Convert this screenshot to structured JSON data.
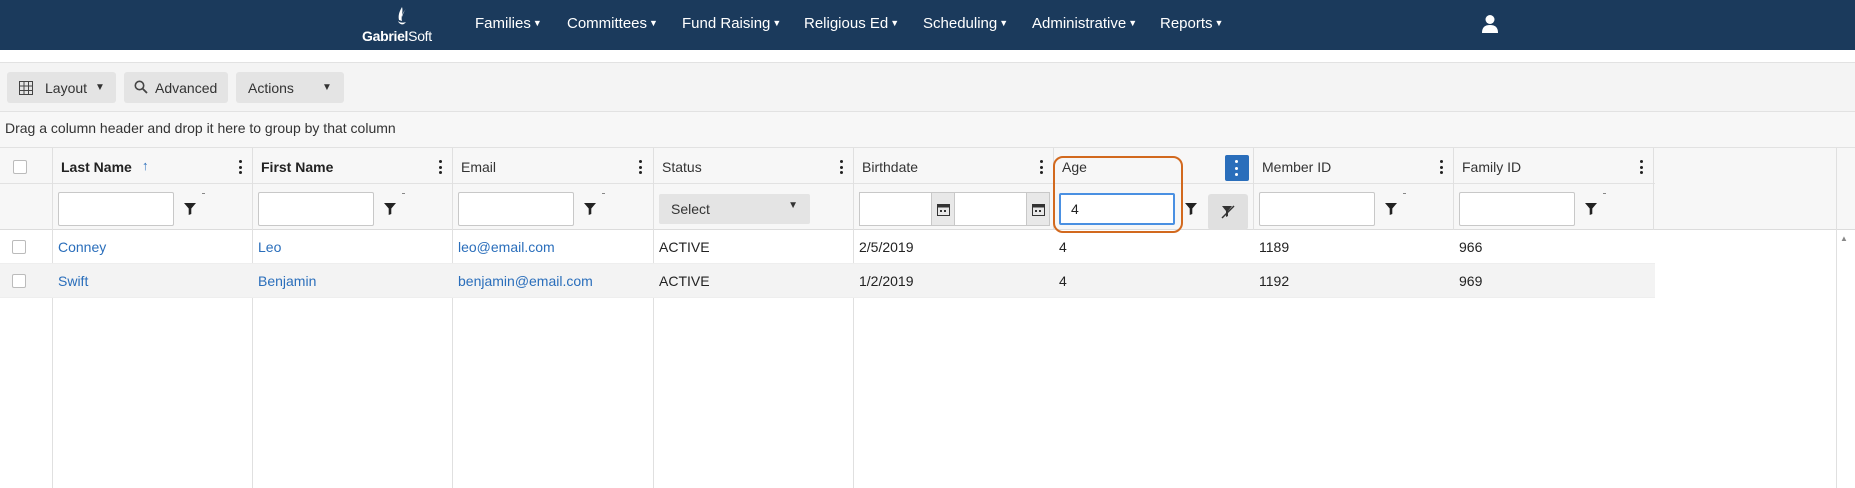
{
  "brand": {
    "name_bold": "Gabriel",
    "name_rest": "Soft"
  },
  "nav": [
    {
      "label": "Families"
    },
    {
      "label": "Committees"
    },
    {
      "label": "Fund Raising"
    },
    {
      "label": "Religious Ed"
    },
    {
      "label": "Scheduling"
    },
    {
      "label": "Administrative"
    },
    {
      "label": "Reports"
    }
  ],
  "icons": {
    "user": "user-icon",
    "grid": "grid-icon",
    "search": "search-icon",
    "filter": "filter-icon",
    "calendar": "calendar-icon",
    "clear_filter": "clear-filter-icon",
    "kebab": "kebab-icon"
  },
  "toolbar": {
    "layout_label": "Layout",
    "advanced_label": "Advanced",
    "actions_label": "Actions"
  },
  "group_hint": "Drag a column header and drop it here to group by that column",
  "columns": [
    {
      "label": "Last Name",
      "sort": "ascending"
    },
    {
      "label": "First Name"
    },
    {
      "label": "Email"
    },
    {
      "label": "Status"
    },
    {
      "label": "Birthdate"
    },
    {
      "label": "Age"
    },
    {
      "label": "Member ID"
    },
    {
      "label": "Family ID"
    }
  ],
  "filters": {
    "status_select": "Select",
    "age_value": "4"
  },
  "rows": [
    {
      "last_name": "Conney",
      "first_name": "Leo",
      "email": "leo@email.com",
      "status": "ACTIVE",
      "birthdate": "2/5/2019",
      "age": "4",
      "member_id": "1189",
      "family_id": "966"
    },
    {
      "last_name": "Swift",
      "first_name": "Benjamin",
      "email": "benjamin@email.com",
      "status": "ACTIVE",
      "birthdate": "1/2/2019",
      "age": "4",
      "member_id": "1192",
      "family_id": "969"
    }
  ],
  "colors": {
    "navbar": "#1b3a5c",
    "link": "#2a6ebb",
    "highlight": "#d2691e",
    "active_menu": "#2a6ebb"
  }
}
